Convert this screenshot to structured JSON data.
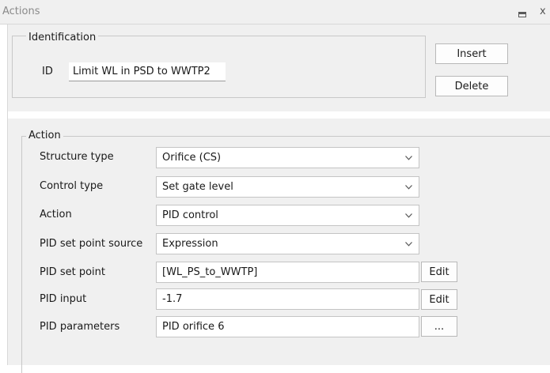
{
  "window": {
    "title": "Actions",
    "restore_icon": "restore-icon",
    "close_glyph": "x"
  },
  "identification": {
    "legend": "Identification",
    "id_label": "ID",
    "id_value": "Limit WL in PSD to WWTP2",
    "insert_label": "Insert",
    "delete_label": "Delete"
  },
  "action": {
    "legend": "Action",
    "fields": {
      "structure_type": {
        "label": "Structure type",
        "value": "Orifice (CS)"
      },
      "control_type": {
        "label": "Control type",
        "value": "Set gate level"
      },
      "action": {
        "label": "Action",
        "value": "PID control"
      },
      "pid_set_point_source": {
        "label": "PID set point source",
        "value": "Expression"
      },
      "pid_set_point": {
        "label": "PID set point",
        "value": "[WL_PS_to_WWTP]",
        "button": "Edit"
      },
      "pid_input": {
        "label": "PID input",
        "value": "-1.7",
        "button": "Edit"
      },
      "pid_parameters": {
        "label": "PID parameters",
        "value": "PID orifice 6",
        "button": "..."
      }
    }
  },
  "colors": {
    "panel_bg": "#f0f0f0",
    "border": "#c4c4c4",
    "title_text": "#8a8a8a"
  }
}
